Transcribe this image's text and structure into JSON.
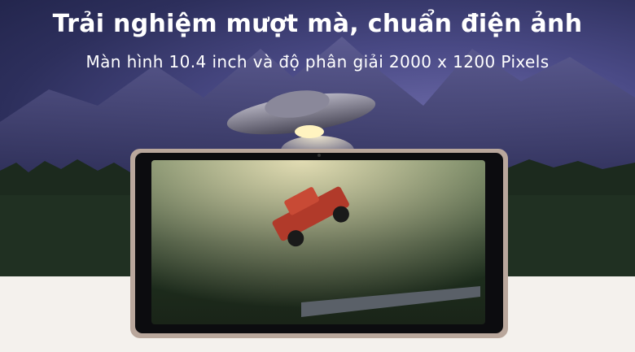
{
  "banner": {
    "headline": "Trải nghiệm mượt mà, chuẩn điện ảnh",
    "subline": "Màn hình 10.4 inch và độ phân giải 2000 x 1200 Pixels"
  },
  "colors": {
    "sky": "#3a3b72",
    "forest": "#1c2a1e",
    "tablet_frame": "#b9a79c",
    "floor": "#f4f1ed",
    "text": "#ffffff"
  }
}
